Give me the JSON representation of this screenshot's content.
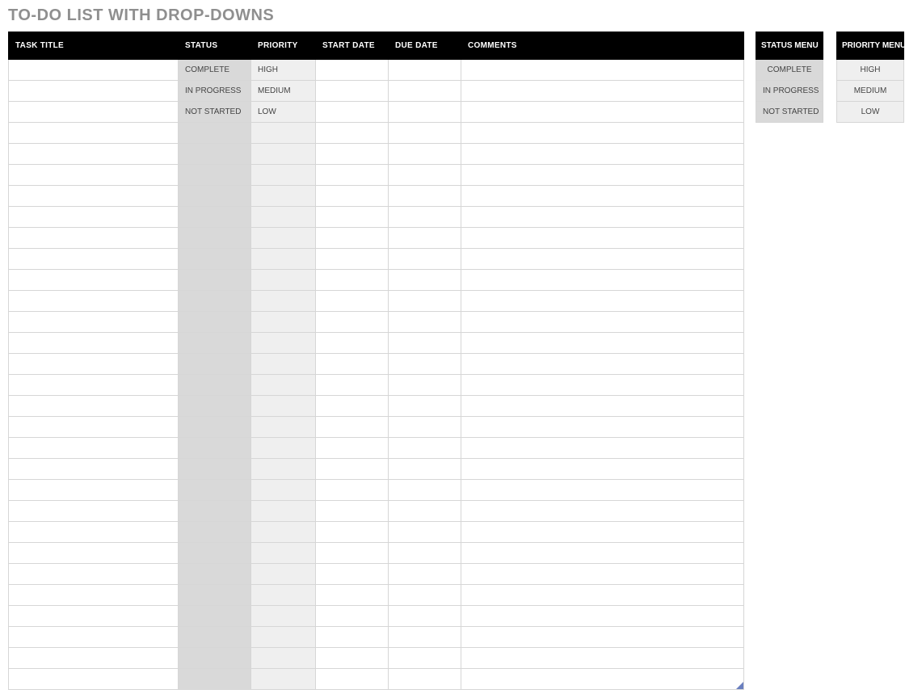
{
  "title": "TO-DO LIST WITH DROP-DOWNS",
  "columns": {
    "task_title": "TASK TITLE",
    "status": "STATUS",
    "priority": "PRIORITY",
    "start_date": "START DATE",
    "due_date": "DUE DATE",
    "comments": "COMMENTS"
  },
  "rows": [
    {
      "task_title": "",
      "status": "COMPLETE",
      "priority": "HIGH",
      "start_date": "",
      "due_date": "",
      "comments": ""
    },
    {
      "task_title": "",
      "status": "IN PROGRESS",
      "priority": "MEDIUM",
      "start_date": "",
      "due_date": "",
      "comments": ""
    },
    {
      "task_title": "",
      "status": "NOT STARTED",
      "priority": "LOW",
      "start_date": "",
      "due_date": "",
      "comments": ""
    },
    {
      "task_title": "",
      "status": "",
      "priority": "",
      "start_date": "",
      "due_date": "",
      "comments": ""
    },
    {
      "task_title": "",
      "status": "",
      "priority": "",
      "start_date": "",
      "due_date": "",
      "comments": ""
    },
    {
      "task_title": "",
      "status": "",
      "priority": "",
      "start_date": "",
      "due_date": "",
      "comments": ""
    },
    {
      "task_title": "",
      "status": "",
      "priority": "",
      "start_date": "",
      "due_date": "",
      "comments": ""
    },
    {
      "task_title": "",
      "status": "",
      "priority": "",
      "start_date": "",
      "due_date": "",
      "comments": ""
    },
    {
      "task_title": "",
      "status": "",
      "priority": "",
      "start_date": "",
      "due_date": "",
      "comments": ""
    },
    {
      "task_title": "",
      "status": "",
      "priority": "",
      "start_date": "",
      "due_date": "",
      "comments": ""
    },
    {
      "task_title": "",
      "status": "",
      "priority": "",
      "start_date": "",
      "due_date": "",
      "comments": ""
    },
    {
      "task_title": "",
      "status": "",
      "priority": "",
      "start_date": "",
      "due_date": "",
      "comments": ""
    },
    {
      "task_title": "",
      "status": "",
      "priority": "",
      "start_date": "",
      "due_date": "",
      "comments": ""
    },
    {
      "task_title": "",
      "status": "",
      "priority": "",
      "start_date": "",
      "due_date": "",
      "comments": ""
    },
    {
      "task_title": "",
      "status": "",
      "priority": "",
      "start_date": "",
      "due_date": "",
      "comments": ""
    },
    {
      "task_title": "",
      "status": "",
      "priority": "",
      "start_date": "",
      "due_date": "",
      "comments": ""
    },
    {
      "task_title": "",
      "status": "",
      "priority": "",
      "start_date": "",
      "due_date": "",
      "comments": ""
    },
    {
      "task_title": "",
      "status": "",
      "priority": "",
      "start_date": "",
      "due_date": "",
      "comments": ""
    },
    {
      "task_title": "",
      "status": "",
      "priority": "",
      "start_date": "",
      "due_date": "",
      "comments": ""
    },
    {
      "task_title": "",
      "status": "",
      "priority": "",
      "start_date": "",
      "due_date": "",
      "comments": ""
    },
    {
      "task_title": "",
      "status": "",
      "priority": "",
      "start_date": "",
      "due_date": "",
      "comments": ""
    },
    {
      "task_title": "",
      "status": "",
      "priority": "",
      "start_date": "",
      "due_date": "",
      "comments": ""
    },
    {
      "task_title": "",
      "status": "",
      "priority": "",
      "start_date": "",
      "due_date": "",
      "comments": ""
    },
    {
      "task_title": "",
      "status": "",
      "priority": "",
      "start_date": "",
      "due_date": "",
      "comments": ""
    },
    {
      "task_title": "",
      "status": "",
      "priority": "",
      "start_date": "",
      "due_date": "",
      "comments": ""
    },
    {
      "task_title": "",
      "status": "",
      "priority": "",
      "start_date": "",
      "due_date": "",
      "comments": ""
    },
    {
      "task_title": "",
      "status": "",
      "priority": "",
      "start_date": "",
      "due_date": "",
      "comments": ""
    },
    {
      "task_title": "",
      "status": "",
      "priority": "",
      "start_date": "",
      "due_date": "",
      "comments": ""
    },
    {
      "task_title": "",
      "status": "",
      "priority": "",
      "start_date": "",
      "due_date": "",
      "comments": ""
    },
    {
      "task_title": "",
      "status": "",
      "priority": "",
      "start_date": "",
      "due_date": "",
      "comments": ""
    }
  ],
  "status_menu": {
    "header": "STATUS MENU",
    "items": [
      "COMPLETE",
      "IN PROGRESS",
      "NOT STARTED"
    ]
  },
  "priority_menu": {
    "header": "PRIORITY MENU",
    "items": [
      "HIGH",
      "MEDIUM",
      "LOW"
    ]
  }
}
